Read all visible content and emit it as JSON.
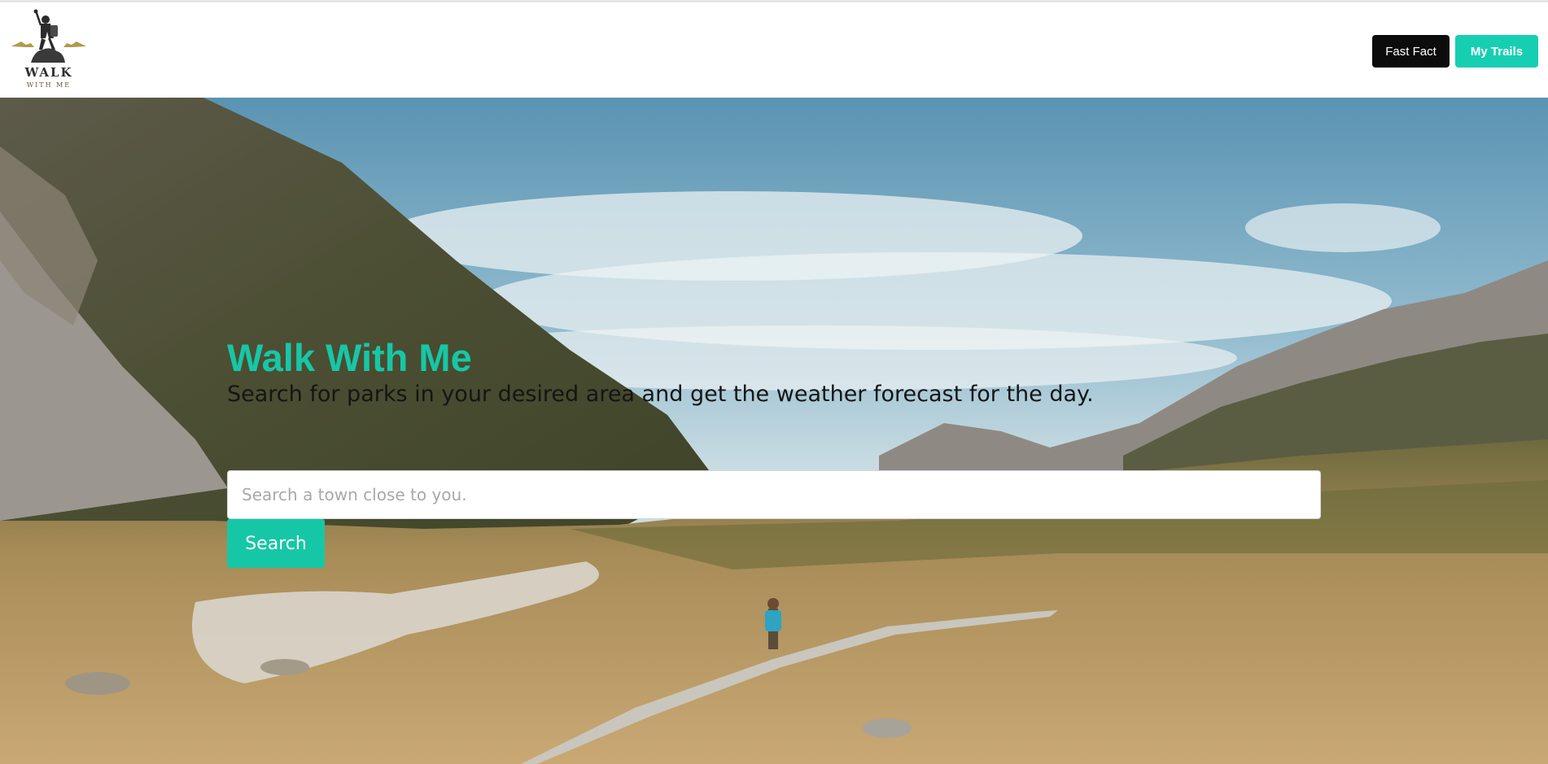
{
  "brand": {
    "logo_title": "WALK",
    "logo_subtitle": "WITH ME",
    "logo_icon": "hiker-logo-icon"
  },
  "nav": {
    "fast_fact_label": "Fast Fact",
    "my_trails_label": "My Trails"
  },
  "hero": {
    "title": "Walk With Me",
    "subtitle": "Search for parks in your desired area and get the weather forecast for the day.",
    "search_placeholder": "Search a town close to you.",
    "search_value": "",
    "search_button_label": "Search",
    "background_image": "mountain-valley-boardwalk-hiker-image"
  },
  "colors": {
    "accent": "#16c7a7",
    "fast_fact_bg": "#0c0c0c",
    "my_trails_bg": "#16cfb2"
  }
}
